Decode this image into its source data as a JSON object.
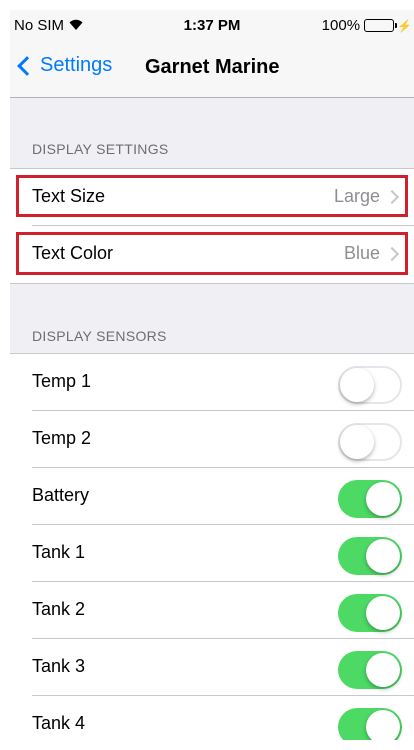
{
  "status_bar": {
    "carrier": "No SIM",
    "time": "1:37 PM",
    "battery": "100%"
  },
  "nav": {
    "back_label": "Settings",
    "title": "Garnet Marine"
  },
  "display_settings": {
    "header": "DISPLAY SETTINGS",
    "rows": [
      {
        "label": "Text Size",
        "value": "Large"
      },
      {
        "label": "Text Color",
        "value": "Blue"
      }
    ]
  },
  "display_sensors": {
    "header": "DISPLAY SENSORS",
    "rows": [
      {
        "label": "Temp 1",
        "on": false
      },
      {
        "label": "Temp 2",
        "on": false
      },
      {
        "label": "Battery",
        "on": true
      },
      {
        "label": "Tank 1",
        "on": true
      },
      {
        "label": "Tank 2",
        "on": true
      },
      {
        "label": "Tank 3",
        "on": true
      },
      {
        "label": "Tank 4",
        "on": true
      }
    ]
  },
  "colors": {
    "accent": "#007aff",
    "toggle_on": "#4cd964",
    "highlight": "#d0202e"
  }
}
